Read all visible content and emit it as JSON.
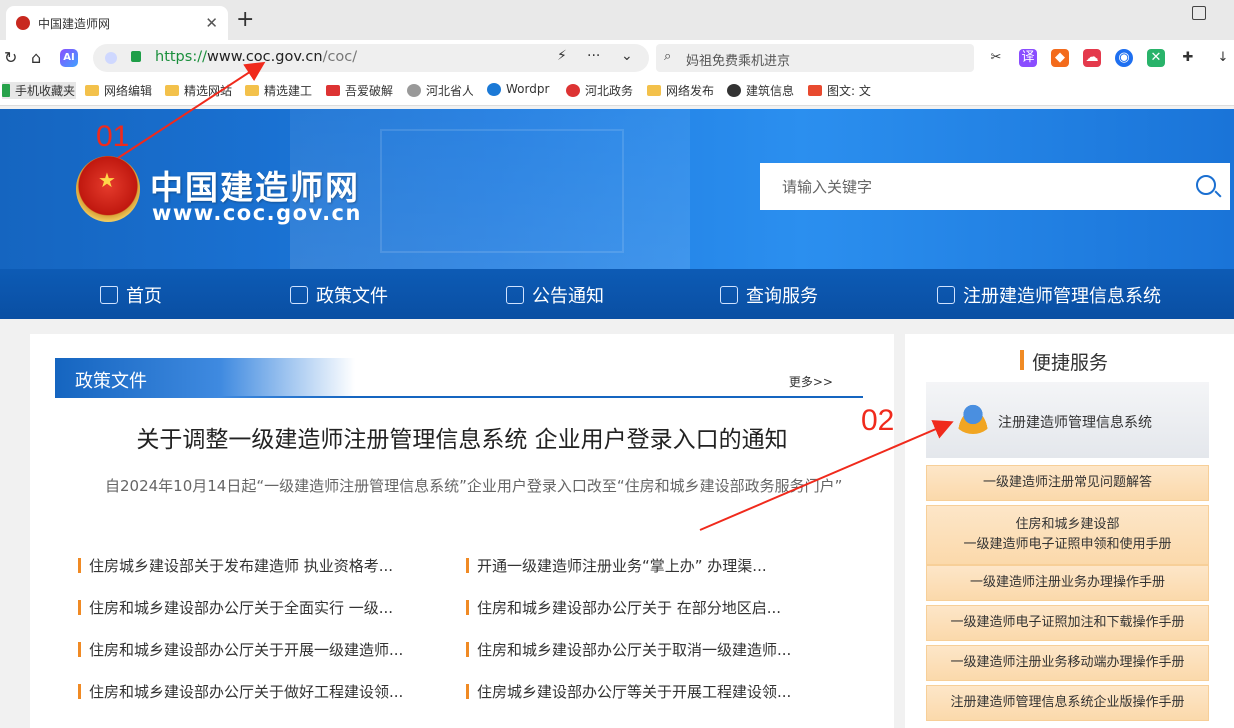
{
  "browser": {
    "tab_title": "中国建造师网",
    "tab_close": "✕",
    "new_tab": "+",
    "url_scheme": "https://",
    "url_host": "www.coc.gov.cn",
    "url_path": "/coc/",
    "search_text": "妈祖免费乘机进京",
    "bookmarks": [
      "手机收藏夹",
      "网络编辑",
      "精选网站",
      "精选建工",
      "吾爱破解",
      "河北省人",
      "Wordpr",
      "河北政务",
      "网络发布",
      "建筑信息",
      "图文: 文"
    ]
  },
  "site": {
    "name": "中国建造师网",
    "domain": "www.coc.gov.cn",
    "search_placeholder": "请输入关键字",
    "nav": [
      "首页",
      "政策文件",
      "公告通知",
      "查询服务",
      "注册建造师管理信息系统"
    ]
  },
  "policy": {
    "section_title": "政策文件",
    "more": "更多>>",
    "headline": "关于调整一级建造师注册管理信息系统 企业用户登录入口的通知",
    "summary": "自2024年10月14日起“一级建造师注册管理信息系统”企业用户登录入口改至“住房和城乡建设部政务服务门户”",
    "items_left": [
      "住房城乡建设部关于发布建造师 执业资格考...",
      "住房和城乡建设部办公厅关于全面实行 一级...",
      "住房和城乡建设部办公厅关于开展一级建造师...",
      "住房和城乡建设部办公厅关于做好工程建设领..."
    ],
    "items_right": [
      "开通一级建造师注册业务“掌上办” 办理渠...",
      "住房和城乡建设部办公厅关于 在部分地区启...",
      "住房和城乡建设部办公厅关于取消一级建造师...",
      "住房城乡建设部办公厅等关于开展工程建设领..."
    ]
  },
  "services": {
    "title": "便捷服务",
    "system_label": "注册建造师管理信息系统",
    "buttons": [
      "一级建造师注册常见问题解答",
      "住房和城乡建设部",
      "一级建造师电子证照申领和使用手册",
      "一级建造师注册业务办理操作手册",
      "一级建造师电子证照加注和下载操作手册",
      "一级建造师注册业务移动端办理操作手册",
      "注册建造师管理信息系统企业版操作手册"
    ]
  },
  "annotations": [
    "01",
    "02"
  ],
  "colors": {
    "site_blue": "#1565c0",
    "nav_blue": "#0a4fa3",
    "accent_orange": "#f08a24",
    "annotation_red": "#f02a1c"
  }
}
